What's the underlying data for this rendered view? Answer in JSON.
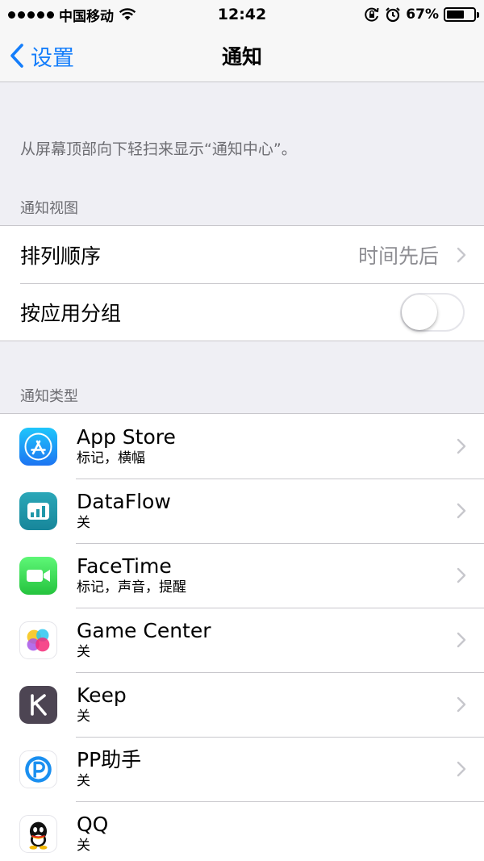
{
  "status_bar": {
    "carrier": "中国移动",
    "time": "12:42",
    "battery_percent_label": "67%",
    "battery_level": 0.67
  },
  "nav": {
    "back_label": "设置",
    "title": "通知"
  },
  "description": "从屏幕顶部向下轻扫来显示“通知中心”。",
  "notification_view": {
    "header": "通知视图",
    "sort_label": "排列顺序",
    "sort_value": "时间先后",
    "group_label": "按应用分组",
    "group_by_app_on": false
  },
  "notification_type": {
    "header": "通知类型",
    "apps": [
      {
        "name": "App Store",
        "status": "标记，横幅",
        "icon": "app-store-icon"
      },
      {
        "name": "DataFlow",
        "status": "关",
        "icon": "dataflow-icon"
      },
      {
        "name": "FaceTime",
        "status": "标记，声音，提醒",
        "icon": "facetime-icon"
      },
      {
        "name": "Game Center",
        "status": "关",
        "icon": "game-center-icon"
      },
      {
        "name": "Keep",
        "status": "关",
        "icon": "keep-icon"
      },
      {
        "name": "PP助手",
        "status": "关",
        "icon": "pp-assistant-icon"
      },
      {
        "name": "QQ",
        "status": "关",
        "icon": "qq-icon"
      }
    ]
  },
  "colors": {
    "accent": "#157efb",
    "background": "#efeff4",
    "separator": "#c8c7cc",
    "secondary_text": "#8e8e93"
  }
}
